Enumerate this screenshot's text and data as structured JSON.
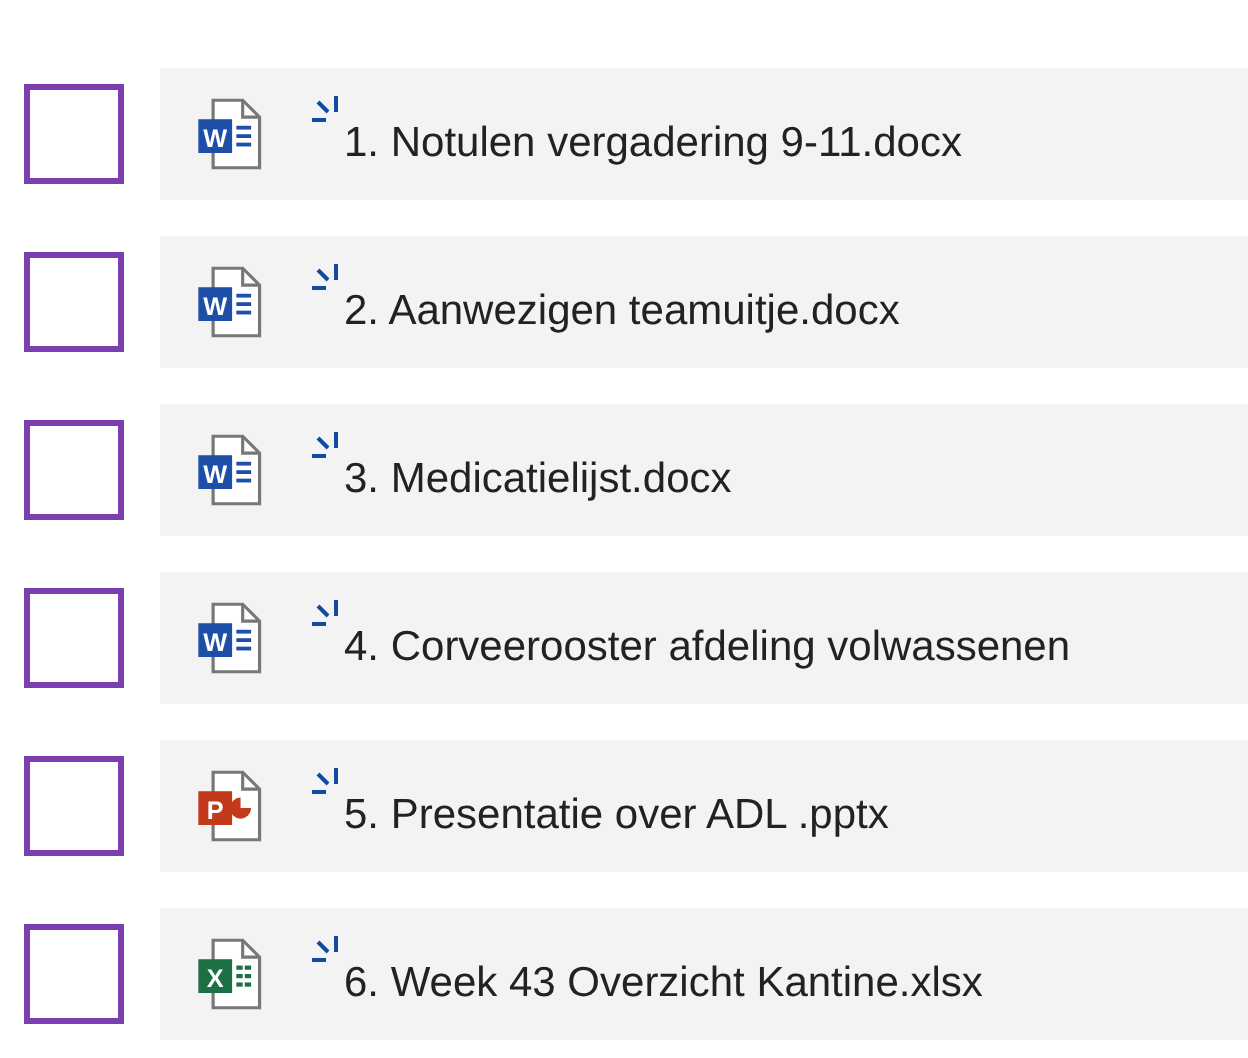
{
  "files": [
    {
      "name": "1. Notulen vergadering 9-11.docx",
      "kind": "word",
      "icon_letter": "W",
      "checked": false
    },
    {
      "name": "2. Aanwezigen teamuitje.docx",
      "kind": "word",
      "icon_letter": "W",
      "checked": false
    },
    {
      "name": "3. Medicatielijst.docx",
      "kind": "word",
      "icon_letter": "W",
      "checked": false
    },
    {
      "name": "4. Corveerooster afdeling volwassenen",
      "kind": "word",
      "icon_letter": "W",
      "checked": false
    },
    {
      "name": "5. Presentatie over ADL .pptx",
      "kind": "powerpoint",
      "icon_letter": "P",
      "checked": false
    },
    {
      "name": "6. Week 43 Overzicht Kantine.xlsx",
      "kind": "excel",
      "icon_letter": "X",
      "checked": false
    }
  ]
}
